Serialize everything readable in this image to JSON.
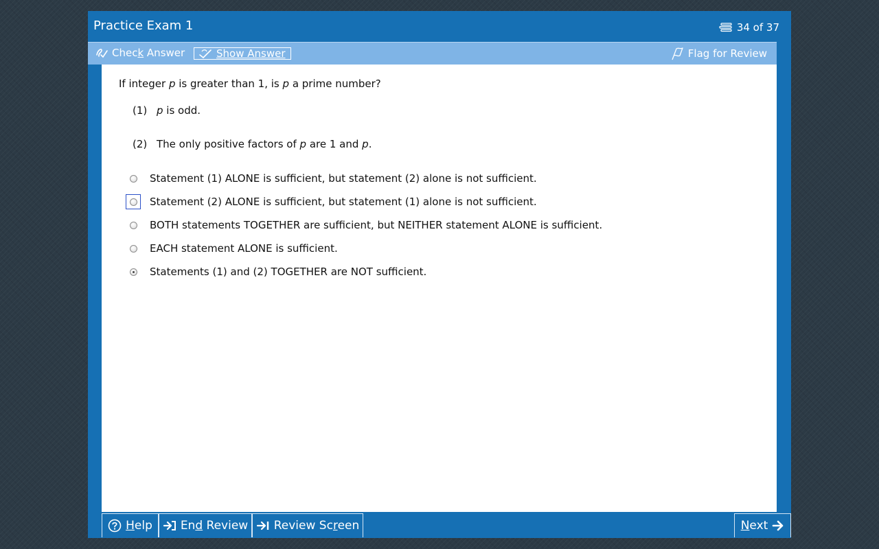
{
  "window": {
    "title": "Practice Exam 1",
    "counter": "34 of 37"
  },
  "toolbar": {
    "check_answer": {
      "pre": "Chec",
      "key": "k",
      "post": " Answer"
    },
    "show_answer": "Show Answer",
    "flag_for_review": "Flag for Review"
  },
  "question": {
    "parts": [
      {
        "t": "If integer ",
        "i": false
      },
      {
        "t": "p",
        "i": true
      },
      {
        "t": " is greater than 1, is ",
        "i": false
      },
      {
        "t": "p",
        "i": true
      },
      {
        "t": " a prime number?",
        "i": false
      }
    ],
    "statements": [
      {
        "num": "(1)",
        "parts": [
          {
            "t": "p",
            "i": true
          },
          {
            "t": " is odd.",
            "i": false
          }
        ]
      },
      {
        "num": "(2)",
        "parts": [
          {
            "t": "The only positive factors of ",
            "i": false
          },
          {
            "t": "p",
            "i": true
          },
          {
            "t": " are 1 and ",
            "i": false
          },
          {
            "t": "p",
            "i": true
          },
          {
            "t": ".",
            "i": false
          }
        ]
      }
    ]
  },
  "options": [
    {
      "label": "Statement (1) ALONE is sufficient, but statement (2) alone is not sufficient.",
      "selected": false,
      "focused": false
    },
    {
      "label": "Statement (2) ALONE is sufficient, but statement (1) alone is not sufficient.",
      "selected": false,
      "focused": true
    },
    {
      "label": "BOTH statements TOGETHER are sufficient, but NEITHER statement ALONE is sufficient.",
      "selected": false,
      "focused": false
    },
    {
      "label": "EACH statement ALONE is sufficient.",
      "selected": false,
      "focused": false
    },
    {
      "label": "Statements (1) and (2) TOGETHER are NOT sufficient.",
      "selected": true,
      "focused": false
    }
  ],
  "bottom": {
    "help": {
      "key": "H",
      "post": "elp"
    },
    "end_review": {
      "pre": "En",
      "key": "d",
      "post": " Review"
    },
    "review_screen": {
      "pre": "Review Sc",
      "key": "r",
      "post": "een"
    },
    "next": {
      "key": "N",
      "post": "ext"
    }
  },
  "icons": {
    "counter": "stack-icon",
    "check": "check-answer-icon",
    "show": "show-answer-icon",
    "flag": "flag-icon",
    "help": "help-circle-icon",
    "end": "end-review-icon",
    "review": "arrow-to-bar-icon",
    "next": "arrow-right-icon"
  },
  "colors": {
    "frame": "#1670b4",
    "toolbar": "#7fb4e6",
    "focus": "#2b50c8"
  }
}
